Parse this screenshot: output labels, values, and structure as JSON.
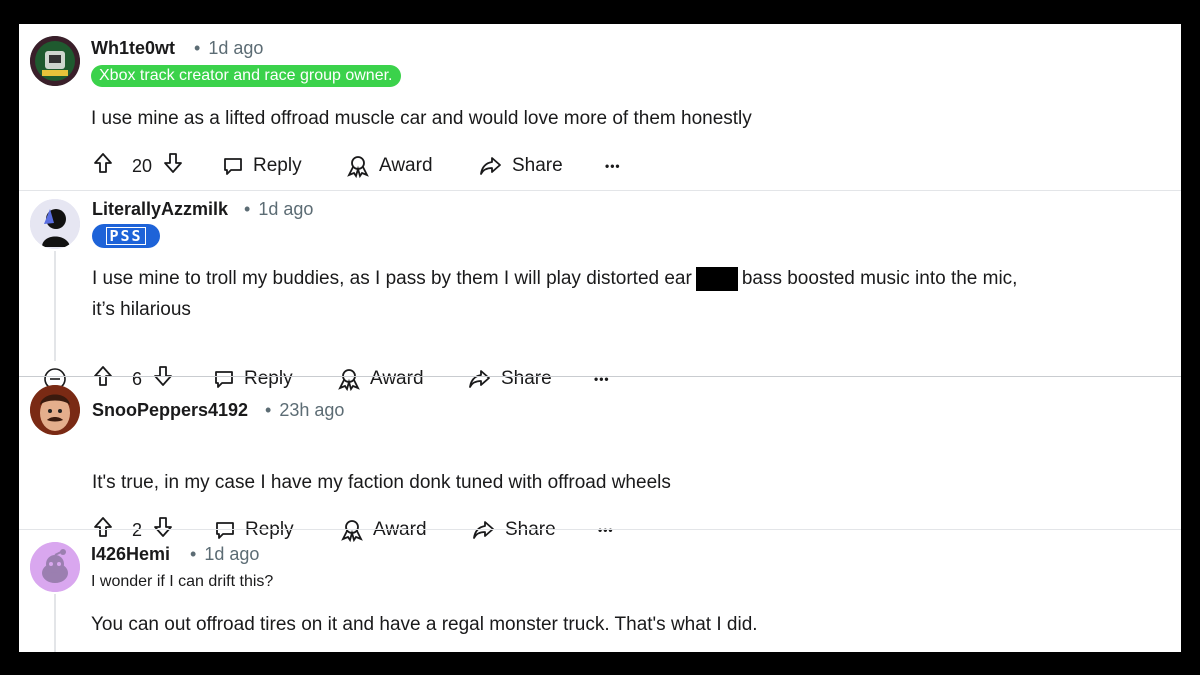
{
  "comments": [
    {
      "username": "Wh1te0wt",
      "time": "1d ago",
      "flair": "Xbox track creator and race group owner.",
      "body": "I use mine as a lifted offroad muscle car and would love more of them honestly",
      "score": "20",
      "actions": {
        "reply": "Reply",
        "award": "Award",
        "share": "Share",
        "more": "•••"
      }
    },
    {
      "username": "LiterallyAzzmilk",
      "time": "1d ago",
      "flair": "PSS",
      "body_part1": "I use mine to troll my buddies, as I pass by them I will play distorted ear",
      "body_part2": "bass boosted music into the mic,",
      "body_line2": "it’s hilarious",
      "score": "6",
      "actions": {
        "reply": "Reply",
        "award": "Award",
        "share": "Share",
        "more": "•••"
      }
    },
    {
      "username": "SnooPeppers4192",
      "time": "23h ago",
      "body": "It's true, in my case I have my faction donk tuned with offroad wheels",
      "score": "2",
      "actions": {
        "reply": "Reply",
        "award": "Award",
        "share": "Share",
        "more": "•••"
      }
    },
    {
      "username": "I426Hemi",
      "time": "1d ago",
      "flair": "I wonder if I can drift this?",
      "body": "You can out offroad tires on it and have a regal monster truck. That's what I did."
    }
  ],
  "colors": {
    "flair_green": "#3bd24b",
    "flair_blue": "#1e63d8",
    "meta": "#5c6c74"
  }
}
